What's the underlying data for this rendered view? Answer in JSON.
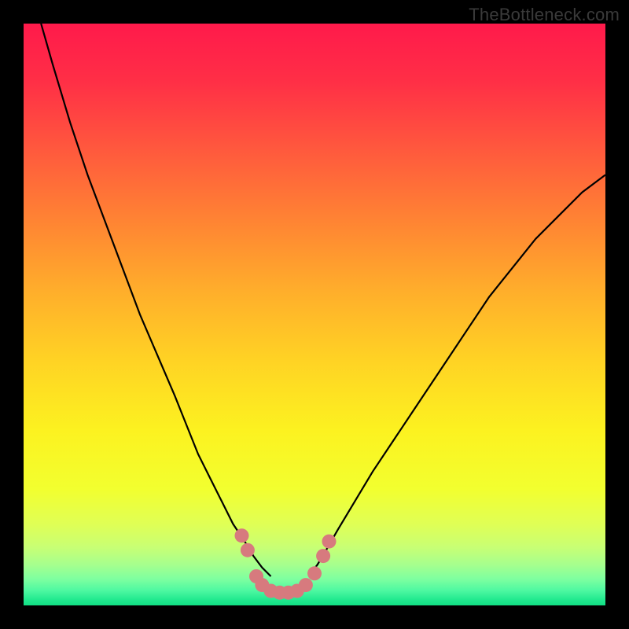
{
  "watermark": "TheBottleneck.com",
  "chart_data": {
    "type": "line",
    "title": "",
    "xlabel": "",
    "ylabel": "",
    "xlim": [
      0,
      100
    ],
    "ylim": [
      0,
      100
    ],
    "curve_left": {
      "x": [
        3,
        5,
        8,
        11,
        14,
        17,
        20,
        23,
        26,
        28,
        30,
        32,
        34,
        36,
        38,
        39.5,
        41,
        42.5
      ],
      "y": [
        100,
        93,
        83,
        74,
        66,
        58,
        50,
        43,
        36,
        31,
        26,
        22,
        18,
        14,
        11,
        8.5,
        6.5,
        5
      ]
    },
    "curve_right": {
      "x": [
        49,
        50.5,
        52,
        54,
        57,
        60,
        64,
        68,
        72,
        76,
        80,
        84,
        88,
        92,
        96,
        100
      ],
      "y": [
        5,
        7,
        9.5,
        13,
        18,
        23,
        29,
        35,
        41,
        47,
        53,
        58,
        63,
        67,
        71,
        74
      ]
    },
    "markers": {
      "x": [
        37.5,
        38.5,
        40.0,
        41.0,
        42.5,
        44.0,
        45.5,
        47.0,
        48.5,
        50.0,
        51.5,
        52.5
      ],
      "y": [
        12.0,
        9.5,
        5.0,
        3.5,
        2.5,
        2.2,
        2.2,
        2.5,
        3.5,
        5.5,
        8.5,
        11.0
      ]
    },
    "gradient_stops": [
      {
        "offset": 0.0,
        "color": "#ff1a4b"
      },
      {
        "offset": 0.1,
        "color": "#ff2f46"
      },
      {
        "offset": 0.22,
        "color": "#ff5a3d"
      },
      {
        "offset": 0.34,
        "color": "#ff8433"
      },
      {
        "offset": 0.46,
        "color": "#ffae2b"
      },
      {
        "offset": 0.58,
        "color": "#ffd324"
      },
      {
        "offset": 0.7,
        "color": "#fcf220"
      },
      {
        "offset": 0.8,
        "color": "#f2ff2f"
      },
      {
        "offset": 0.86,
        "color": "#e0ff55"
      },
      {
        "offset": 0.9,
        "color": "#c8ff74"
      },
      {
        "offset": 0.93,
        "color": "#a6ff8e"
      },
      {
        "offset": 0.955,
        "color": "#7dffa0"
      },
      {
        "offset": 0.975,
        "color": "#4cf8a1"
      },
      {
        "offset": 0.99,
        "color": "#22e98f"
      },
      {
        "offset": 1.0,
        "color": "#11df84"
      }
    ],
    "marker_color": "#d77a7e",
    "curve_color": "#000000"
  }
}
